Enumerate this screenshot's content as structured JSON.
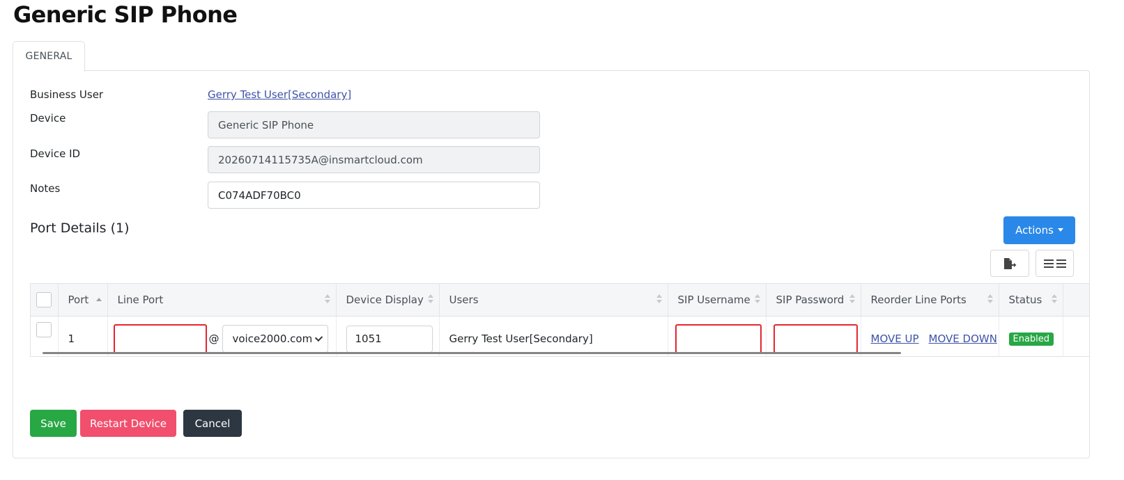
{
  "page": {
    "title": "Generic SIP Phone"
  },
  "tabs": [
    {
      "label": "GENERAL"
    }
  ],
  "form": {
    "business_user_label": "Business User",
    "business_user_value": "Gerry Test User[Secondary]",
    "device_label": "Device",
    "device_value": "Generic SIP Phone",
    "device_id_label": "Device ID",
    "device_id_value": "20260714115735A@insmartcloud.com",
    "notes_label": "Notes",
    "notes_value": "C074ADF70BC0"
  },
  "port_details": {
    "title": "Port Details (1)",
    "actions_label": "Actions",
    "columns": [
      "Port",
      "Line Port",
      "Device Display",
      "Users",
      "SIP Username",
      "SIP Password",
      "Reorder Line Ports",
      "Status"
    ],
    "rows": [
      {
        "port": "1",
        "line_port": "",
        "at": "@",
        "domain": "voice2000.com",
        "device_display": "1051",
        "users": "Gerry Test User[Secondary]",
        "sip_username": "",
        "sip_password": "",
        "move_up": "MOVE UP",
        "move_down": "MOVE DOWN",
        "status": "Enabled"
      }
    ]
  },
  "footer": {
    "save": "Save",
    "restart": "Restart Device",
    "cancel": "Cancel"
  },
  "icons": {
    "export": "file-export-icon",
    "columns": "column-toggle-icon"
  },
  "colors": {
    "primary": "#2a88e8",
    "success": "#28a745",
    "danger": "#f14f6d",
    "dark": "#2d3742",
    "error_border": "#e4262e",
    "link": "#3d52a9"
  }
}
